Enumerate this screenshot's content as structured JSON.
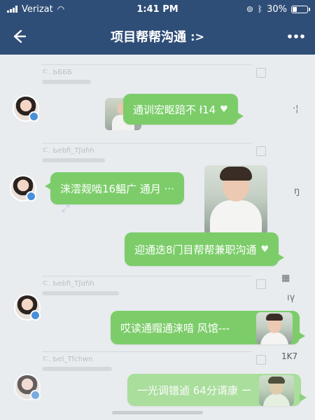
{
  "status_bar": {
    "carrier": "Verizat",
    "time": "1:41 PM",
    "battery": "30%",
    "battery_level": 0.3
  },
  "nav": {
    "title": "项目帮帮沟通",
    "title_suffix": ":>",
    "back_icon": "back-arrow-icon",
    "more_icon": "more-dots-icon"
  },
  "messages": [
    {
      "side": "right",
      "text": "通训宏眍踣不 ł14"
    },
    {
      "side": "left",
      "text": "涞澐觌啮16鲳广 通月 ···"
    },
    {
      "side": "right",
      "text": "迎通迭8门目帮帮兼职沟通"
    },
    {
      "side": "right",
      "text": "哎读通赗通涞喑 风馆---"
    },
    {
      "side": "right",
      "text": "一光调镨逌 64分谞康 ー"
    }
  ],
  "side_marks": {
    "m1": "·¦",
    "m2": "ŋ",
    "m3": "▦",
    "m4": "ıγ",
    "m5": "1K7"
  },
  "background_headers": {
    "h1": "ㄷ. ƄƂƂƂ",
    "h2": "ㄷ. Ƅebfi_Tʃɑɦh",
    "h3": "ㄷ. Ƅebfi_Tʃɑɦh",
    "h4": "ㄷ. Ƅel_Tſchwn"
  },
  "colors": {
    "header_bg": "#2f4e77",
    "bubble": "#7ccd6a",
    "background": "#e9ecef"
  }
}
